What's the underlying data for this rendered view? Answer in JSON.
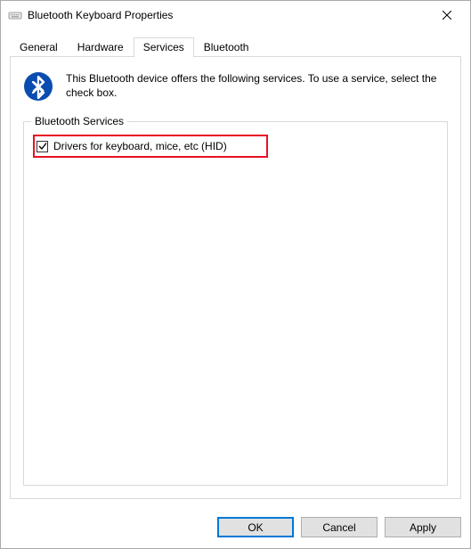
{
  "window": {
    "title": "Bluetooth Keyboard Properties"
  },
  "tabs": {
    "general": "General",
    "hardware": "Hardware",
    "services": "Services",
    "bluetooth": "Bluetooth",
    "active": "services"
  },
  "services": {
    "intro": "This Bluetooth device offers the following services. To use a service, select the check box.",
    "group_label": "Bluetooth Services",
    "items": [
      {
        "label": "Drivers for keyboard, mice, etc (HID)",
        "checked": true
      }
    ]
  },
  "buttons": {
    "ok": "OK",
    "cancel": "Cancel",
    "apply": "Apply"
  }
}
